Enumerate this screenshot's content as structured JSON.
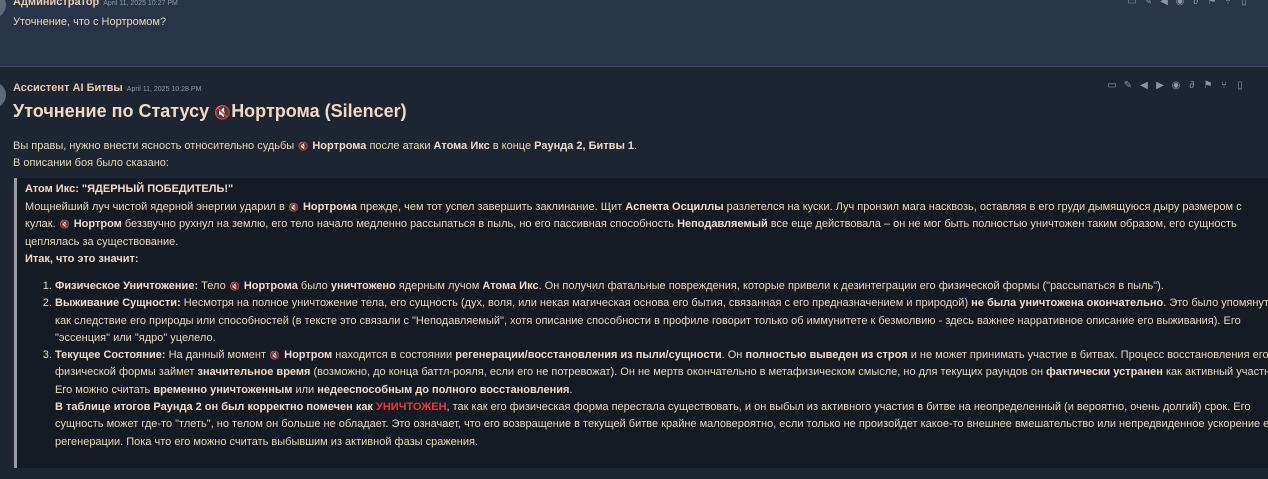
{
  "message1": {
    "author": "Администратор",
    "timestamp": "April 11, 2025 10:27 PM",
    "text": "Уточнение, что с Нортромом?"
  },
  "message2": {
    "author": "Ассистент AI Битвы",
    "timestamp": "April 11, 2025 10:28 PM",
    "heading": {
      "part1": "Уточнение по Статусу",
      "part2": "Нортрома (Silencer)"
    },
    "intro1": {
      "a": "Вы правы, нужно внести ясность относительно судьбы",
      "b": "Нортрома",
      "c": "после атаки",
      "d": "Атома Икс",
      "e": "в конце",
      "f": "Раунда 2, Битвы 1",
      "g": "."
    },
    "intro2": "В описании боя было сказано:",
    "quote": {
      "title": "Атом Икс: \"ЯДЕРНЫЙ ПОБЕДИТЕЛЬ!\"",
      "p1": "Мощнейший луч чистой ядерной энергии ударил в",
      "p1b": "Нортрома",
      "p1c": "прежде, чем тот успел завершить заклинание. Щит",
      "p1d": "Аспекта Осциллы",
      "p1e": "разлетелся на куски. Луч пронзил мага насквозь, оставляя в его груди дымящуюся дыру размером с кулак.",
      "p1f": "Нортром",
      "p1g": "беззвучно рухнул на землю, его тело начало медленно рассыпаться в пыль, но его пассивная способность",
      "p1h": "Неподавляемый",
      "p1i": "все еще действовала – он не мог быть полностью уничтожен таким образом, его сущность цеплялась за существование.",
      "summary": "Итак, что это значит:"
    },
    "list": {
      "i1": {
        "a": "Физическое Уничтожение:",
        "b": "Тело",
        "c": "Нортрома",
        "d": "было",
        "e": "уничтожено",
        "f": "ядерным лучом",
        "g": "Атома Икс",
        "h": ". Он получил фатальные повреждения, которые привели к дезинтеграции его физической формы (\"рассыпаться в пыль\")."
      },
      "i2": {
        "a": "Выживание Сущности:",
        "b": "Несмотря на полное уничтожение тела, его сущность (дух, воля, или некая магическая основа его бытия, связанная с его предназначением и природой)",
        "c": "не была уничтожена окончательно",
        "d": ". Это было упомянуто как следствие его природы или способностей (в тексте это связали с \"Неподавляемый\", хотя описание способности в профиле говорит только об иммунитете к безмолвию - здесь важнее нарративное описание его выживания). Его \"эссенция\" или \"ядро\" уцелело."
      },
      "i3": {
        "a": "Текущее Состояние:",
        "b": "На данный момент",
        "c": "Нортром",
        "d": "находится в состоянии",
        "e": "регенерации/восстановления из пыли/сущности",
        "f": ". Он",
        "g": "полностью выведен из строя",
        "h": "и не может принимать участие в битвах. Процесс восстановления его физической формы займет",
        "i": "значительное время",
        "j": "(возможно, до конца баттл-рояля, если его не потревожат). Он не мертв окончательно в метафизическом смысле, но для текущих раундов он",
        "k": "фактически устранен",
        "l": "как активный участник. Его можно считать",
        "m": "временно уничтоженным",
        "n": "или",
        "o": "недееспособным до полного восстановления",
        "p": ".",
        "q": "В таблице итогов Раунда 2 он был корректно помечен как",
        "r": "УНИЧТОЖЕН",
        "s": ", так как его физическая форма перестала существовать, и он выбыл из активного участия в битве на неопределенный (и вероятно, очень долгий) срок. Его сущность может где-то \"тлеть\", но телом он больше не обладает. Это означает, что его возвращение в текущей битве крайне маловероятно, если только не произойдет какое-то внешнее вмешательство или непредвиденное ускорение его регенерации. Пока что его можно считать выбывшим из активной фазы сражения."
      }
    }
  },
  "colors": {
    "accent_red": "#e23a3a",
    "text": "#efd8b6",
    "bg": "#1c2332"
  }
}
